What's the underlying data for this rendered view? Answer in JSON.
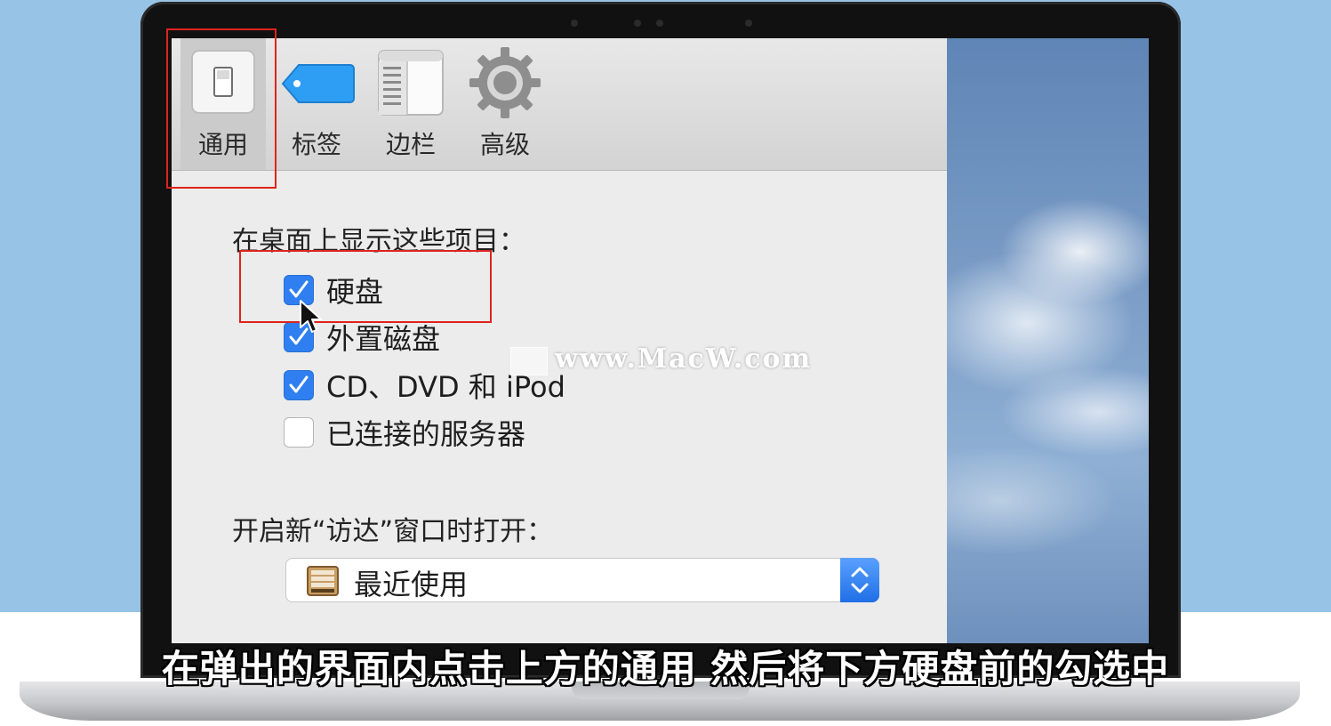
{
  "toolbar": {
    "tabs": [
      {
        "label": "通用",
        "icon": "general-switch-icon",
        "selected": true
      },
      {
        "label": "标签",
        "icon": "tag-icon",
        "selected": false
      },
      {
        "label": "边栏",
        "icon": "sidebar-icon",
        "selected": false
      },
      {
        "label": "高级",
        "icon": "gear-icon",
        "selected": false
      }
    ]
  },
  "general": {
    "desktop_section_title": "在桌面上显示这些项目：",
    "desktop_items": [
      {
        "label": "硬盘",
        "checked": true
      },
      {
        "label": "外置磁盘",
        "checked": true
      },
      {
        "label": "CD、DVD 和 iPod",
        "checked": true
      },
      {
        "label": "已连接的服务器",
        "checked": false
      }
    ],
    "new_window_title": "开启新“访达”窗口时打开：",
    "new_window_value": "最近使用"
  },
  "overlay": {
    "watermark": "www.MacW.com",
    "subtitle": "在弹出的界面内点击上方的通用 然后将下方硬盘前的勾选中",
    "highlight_color": "#e0231c"
  },
  "colors": {
    "checkbox_blue": "#2f7ff0",
    "background_blue": "#97c3e6"
  }
}
